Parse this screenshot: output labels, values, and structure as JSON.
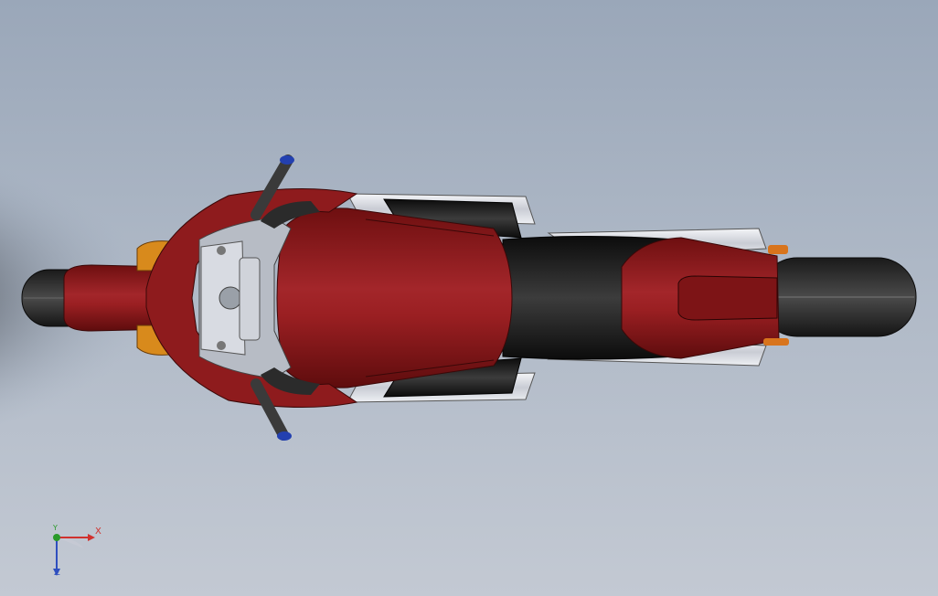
{
  "viewport": {
    "background_top": "#9aa7b9",
    "background_bottom": "#c3c9d3"
  },
  "model": {
    "body_color": "#8b1a1a",
    "dark_color": "#1e1e1e",
    "chrome_color": "#e6e8ee",
    "accent_color": "#d88a1c",
    "grip_end_color": "#2340b0"
  },
  "triad": {
    "x_label": "X",
    "y_label": "Y",
    "z_label": "Z",
    "x_color": "#d0312d",
    "y_color": "#2a9a2a",
    "z_color": "#2f4fbf"
  }
}
